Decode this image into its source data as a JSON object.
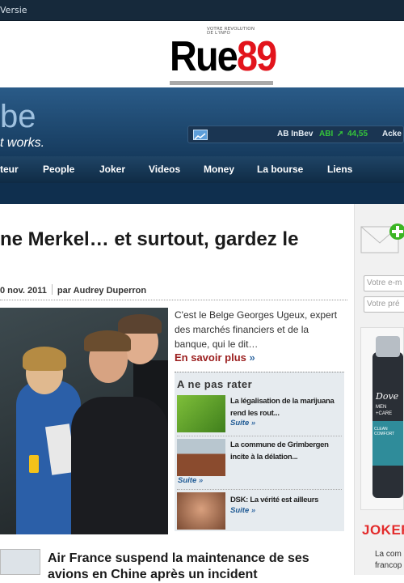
{
  "top_bar": {
    "version_link": "Versie"
  },
  "logo": {
    "tagline": "VOTRE REVOLUTION DE L'INFO",
    "name_part1": "Rue",
    "name_part2": "89"
  },
  "banner": {
    "brand_fragment": "be",
    "slogan_fragment": "t works."
  },
  "ticker": {
    "company": "AB InBev",
    "symbol": "ABI",
    "value": "44,55",
    "next": "Acke"
  },
  "nav": {
    "items": [
      "teur",
      "People",
      "Joker",
      "Videos",
      "Money",
      "La bourse",
      "Liens"
    ]
  },
  "article": {
    "headline": "ne Merkel… et surtout, gardez le",
    "date": "0 nov. 2011",
    "author": "par Audrey Duperron",
    "intro": "C'est le Belge Georges Ugeux, expert des marchés financiers et de la banque, qui le dit…",
    "read_more": "En savoir plus",
    "read_more_arrow": "»"
  },
  "a_ne_pas_rater": {
    "title": "A ne pas rater",
    "items": [
      {
        "text": "La légalisation de la marijuana rend les rout...",
        "suite": "Suite"
      },
      {
        "text": "La commune de Grimbergen incite à la délation...",
        "suite": "Suite"
      },
      {
        "text": "DSK: La vérité est ailleurs",
        "suite": "Suite"
      }
    ],
    "arrow": "»"
  },
  "second_article": {
    "title": "Air France suspend la maintenance de ses avions en Chine après un incident"
  },
  "sidebar": {
    "email_placeholder": "Votre e-m",
    "firstname_placeholder": "Votre pré",
    "joker_label": "JOKER",
    "side_text_1": "La com",
    "side_text_2": "francop"
  },
  "ad": {
    "brand": "Dove",
    "line1": "MEN",
    "line2": "+CARE",
    "line3": "CLEAN COMFORT"
  },
  "colors": {
    "brand_red": "#e2141c",
    "nav_bg": "#0f2b45",
    "ticker_up": "#35c43a",
    "read_more": "#9b1e1e"
  }
}
